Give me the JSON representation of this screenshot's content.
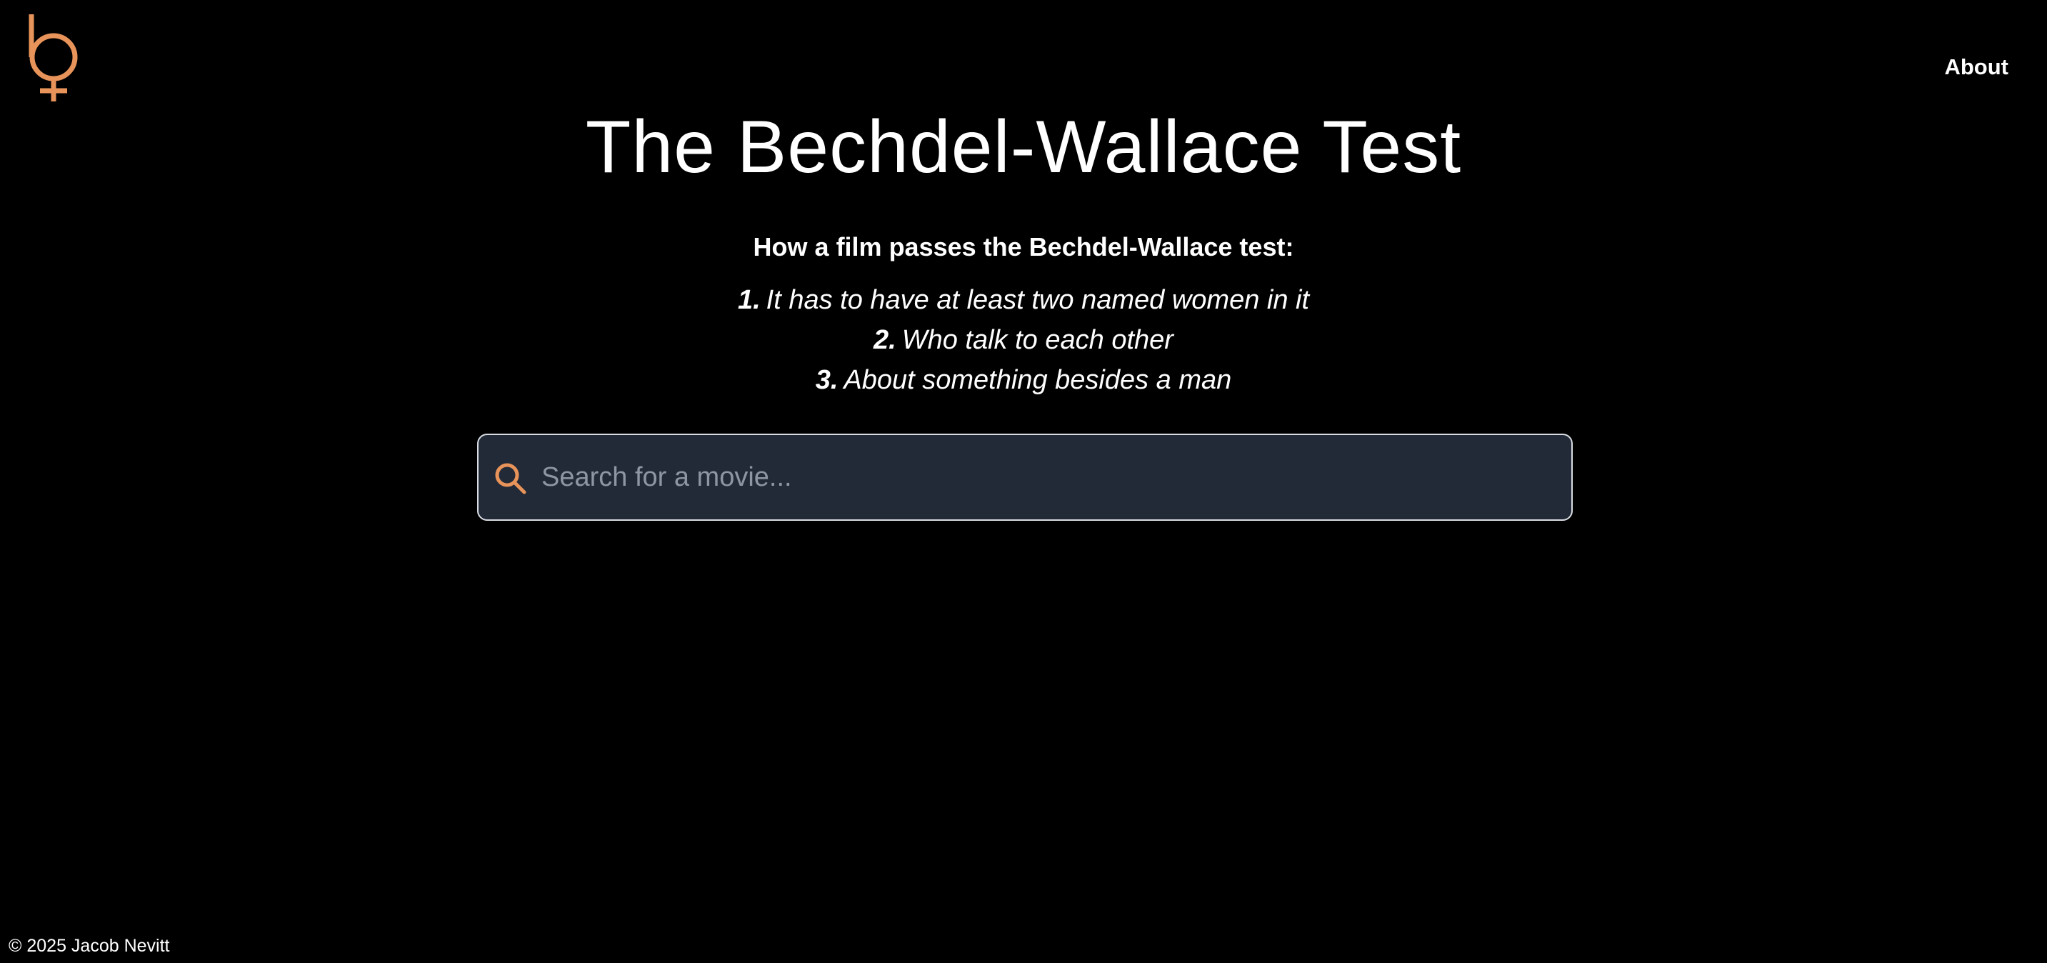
{
  "logo": {
    "icon": "bechdel-venus-b-icon",
    "color": "#e8935a"
  },
  "nav": {
    "about_label": "About"
  },
  "header": {
    "title": "The Bechdel-Wallace Test"
  },
  "intro": {
    "heading": "How a film passes the Bechdel-Wallace test:"
  },
  "rules": [
    {
      "number": "1.",
      "text": "It has to have at least two named women in it"
    },
    {
      "number": "2.",
      "text": "Who talk to each other"
    },
    {
      "number": "3.",
      "text": "About something besides a man"
    }
  ],
  "search": {
    "icon": "search-icon",
    "placeholder": "Search for a movie...",
    "value": ""
  },
  "footer": {
    "copyright": "© 2025 Jacob Nevitt"
  },
  "colors": {
    "accent": "#e8935a",
    "background": "#000000",
    "search_background": "#222a37",
    "search_border": "#d9dde3"
  }
}
